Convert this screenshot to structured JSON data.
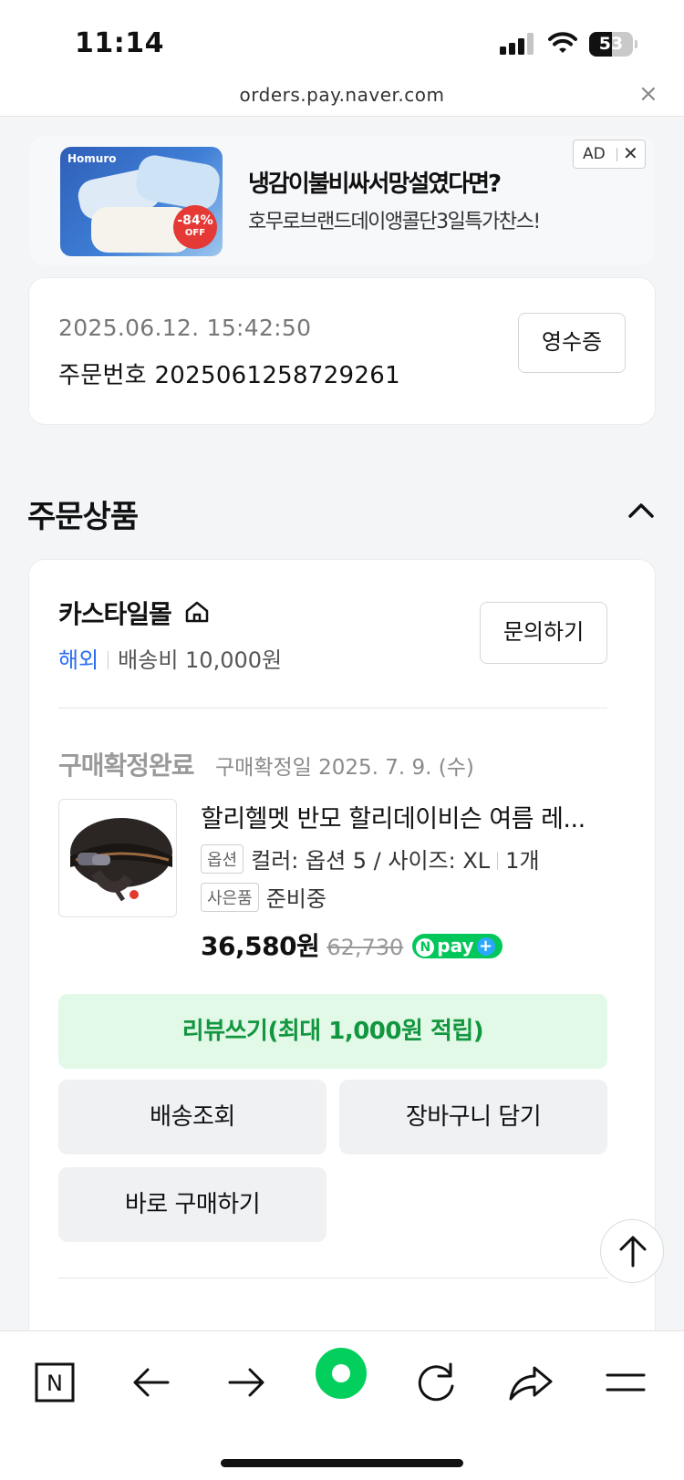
{
  "status_bar": {
    "time": "11:14",
    "battery": "53",
    "battery_level": 0.53
  },
  "browser": {
    "url": "orders.pay.naver.com",
    "close_glyph": "×"
  },
  "ad": {
    "brand": "Homuro",
    "discount": "-84%",
    "discount_off": "OFF",
    "title": "냉감이불비싸서망설였다면?",
    "subtitle": "호무로브랜드데이앵콜단3일특가찬스!",
    "badge": "AD",
    "close_glyph": "✕"
  },
  "order": {
    "datetime": "2025.06.12. 15:42:50",
    "number": "주문번호 2025061258729261",
    "receipt_button": "영수증"
  },
  "section": {
    "title": "주문상품"
  },
  "store": {
    "name": "카스타일몰",
    "region": "해외",
    "shipping": "배송비 10,000원",
    "inquiry_button": "문의하기"
  },
  "item": {
    "status": "구매확정완료",
    "confirm_date": "구매확정일 2025. 7. 9. (수)",
    "title": "할리헬멧 반모 할리데이비슨 여름 레...",
    "option_tag": "옵션",
    "option_text": "컬러: 옵션 5 / 사이즈: XL",
    "quantity": "1개",
    "gift_tag": "사은품",
    "gift_text": "준비중",
    "price": "36,580원",
    "original_price": "62,730",
    "npay_n": "N",
    "npay_label": "pay",
    "npay_plus": "+"
  },
  "actions": {
    "review": "리뷰쓰기(최대 1,000원 적립)",
    "tracking": "배송조회",
    "cart": "장바구니 담기",
    "buy_now": "바로 구매하기"
  },
  "toolbar": {
    "naver_label": "N"
  },
  "colors": {
    "accent_green": "#03c75a",
    "link_blue": "#2a6df4",
    "review_bg": "#e2f9e7"
  }
}
